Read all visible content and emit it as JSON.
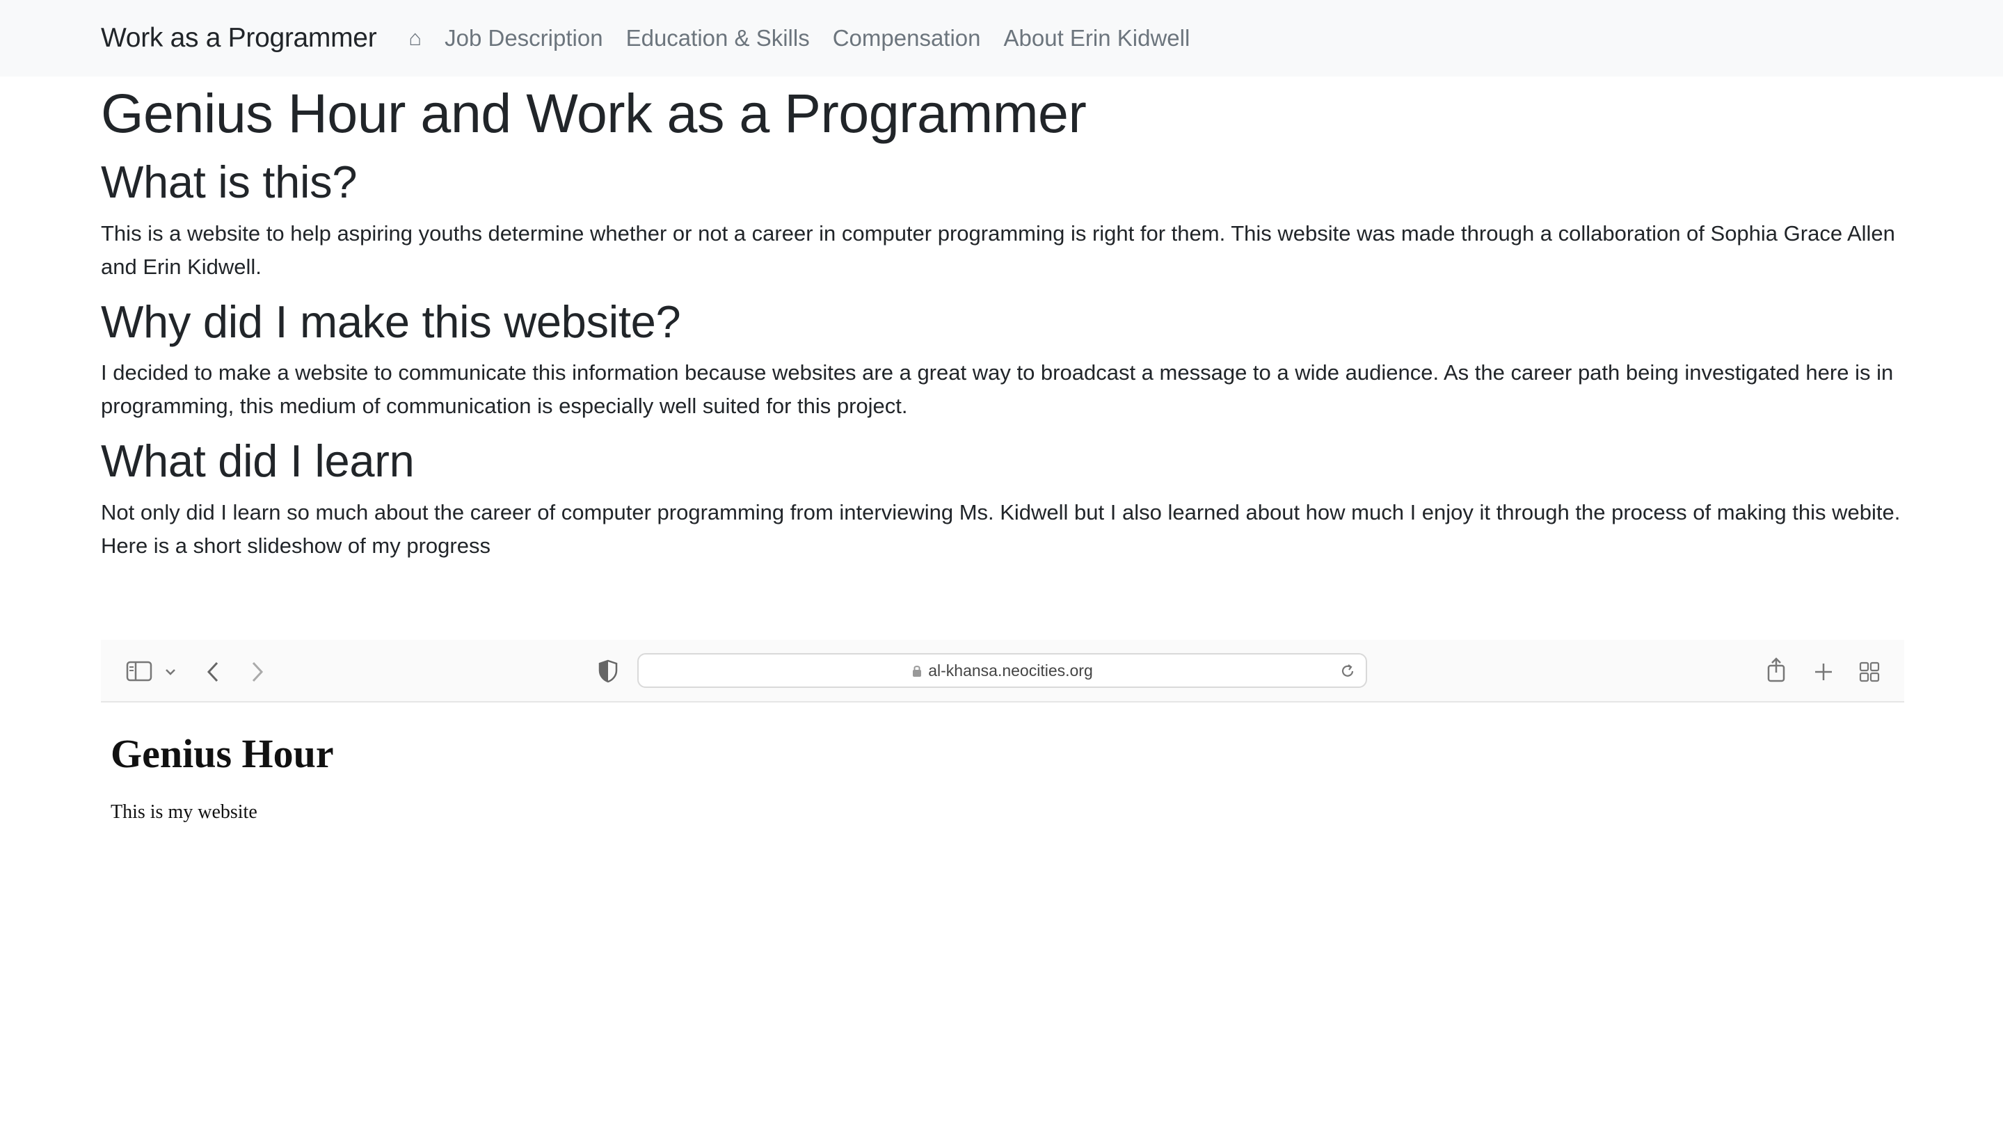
{
  "navbar": {
    "brand": "Work as a Programmer",
    "home_glyph": "⌂",
    "links": [
      "Job Description",
      "Education & Skills",
      "Compensation",
      "About Erin Kidwell"
    ]
  },
  "main": {
    "title": "Genius Hour and Work as a Programmer",
    "sections": [
      {
        "heading": "What is this?",
        "body": "This is a website to help aspiring youths determine whether or not a career in computer programming is right for them. This website was made through a collaboration of Sophia Grace Allen and Erin Kidwell."
      },
      {
        "heading": "Why did I make this website?",
        "body": "I decided to make a website to communicate this information because websites are a great way to broadcast a message to a wide audience. As the career path being investigated here is in programming, this medium of communication is especially well suited for this project."
      },
      {
        "heading": "What did I learn",
        "body": "Not only did I learn so much about the career of computer programming from interviewing Ms. Kidwell but I also learned about how much I enjoy it through the process of making this webite. Here is a short slideshow of my progress"
      }
    ]
  },
  "slideshow": {
    "url": "al-khansa.neocities.org",
    "inner_title": "Genius Hour",
    "inner_text": "This is my website"
  },
  "colors": {
    "navbar_bg": "#f8f9fa",
    "brand": "#212529",
    "nav_link": "#6c757d",
    "text": "#212529"
  }
}
